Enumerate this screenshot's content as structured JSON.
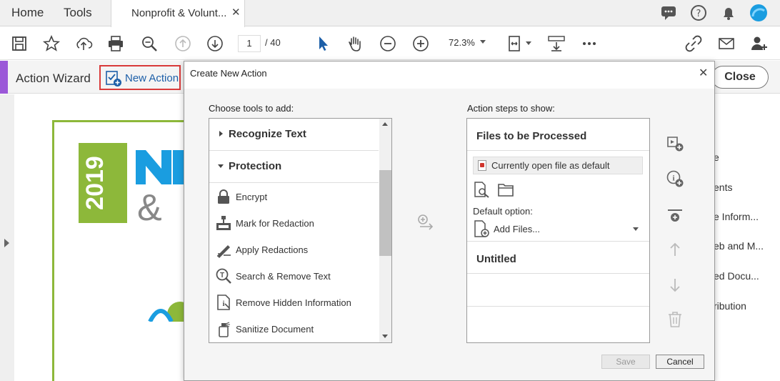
{
  "tabs": {
    "home": "Home",
    "tools": "Tools",
    "doc_title": "Nonprofit & Volunt...",
    "doc_close": "✕"
  },
  "toolbar": {
    "page_current": "1",
    "page_total": "/ 40",
    "zoom": "72.3%"
  },
  "wizard": {
    "title": "Action Wizard",
    "new_action": "New Action",
    "close": "Close"
  },
  "right_pane": {
    "items": [
      "e",
      "ents",
      "e Inform...",
      "eb and M...",
      "ed Docu...",
      "ribution"
    ]
  },
  "dialog": {
    "title": "Create New Action",
    "choose_label": "Choose tools to add:",
    "steps_label": "Action steps to show:",
    "sections": [
      {
        "label": "Recognize Text",
        "expanded": false
      },
      {
        "label": "Protection",
        "expanded": true
      }
    ],
    "tools": [
      {
        "label": "Encrypt",
        "icon": "lock-icon"
      },
      {
        "label": "Mark for Redaction",
        "icon": "redaction-mark-icon"
      },
      {
        "label": "Apply Redactions",
        "icon": "apply-redactions-icon"
      },
      {
        "label": "Search & Remove Text",
        "icon": "search-remove-text-icon"
      },
      {
        "label": "Remove Hidden Information",
        "icon": "remove-hidden-info-icon"
      },
      {
        "label": "Sanitize Document",
        "icon": "sanitize-icon"
      }
    ],
    "steps": {
      "files_header": "Files to be Processed",
      "current_file": "Currently open file as default",
      "default_option": "Default option:",
      "add_files": "Add Files...",
      "untitled": "Untitled"
    },
    "buttons": {
      "save": "Save",
      "cancel": "Cancel"
    }
  },
  "colors": {
    "accent_purple": "#9b58d8",
    "highlight_red": "#d93a3a",
    "link_blue": "#1d5fa8",
    "doc_green": "#8db83a"
  }
}
